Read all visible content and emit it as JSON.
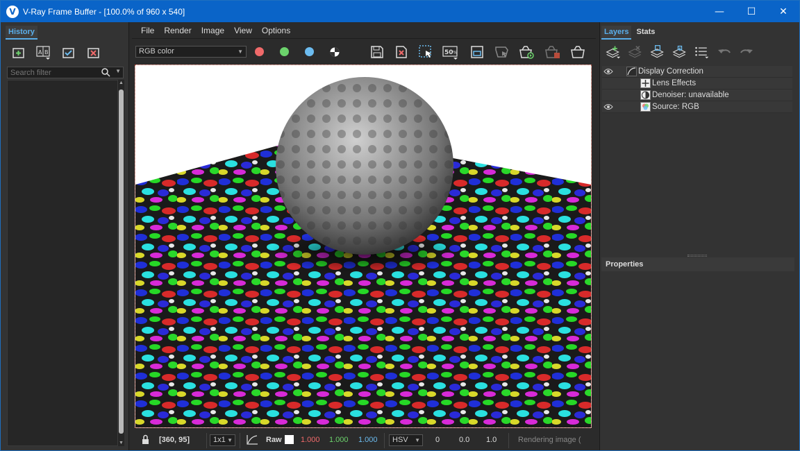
{
  "window": {
    "title": "V-Ray Frame Buffer - [100.0% of 960 x 540]",
    "app_icon_glyph": "V",
    "minimize": "—",
    "maximize": "☐",
    "close": "✕"
  },
  "history": {
    "tab_label": "History",
    "search_placeholder": "Search filter",
    "tool_icons": [
      "save-to-history-icon",
      "ab-compare-icon",
      "load-history-icon",
      "remove-history-icon"
    ]
  },
  "menu": {
    "items": [
      "File",
      "Render",
      "Image",
      "View",
      "Options"
    ]
  },
  "toolbar": {
    "channel_select_value": "RGB color",
    "channel_dots": [
      {
        "name": "red-channel",
        "color": "#f06a6a"
      },
      {
        "name": "green-channel",
        "color": "#6cd36c"
      },
      {
        "name": "blue-channel",
        "color": "#6cbcf0"
      }
    ],
    "icons": [
      "monochrome-icon",
      "save-image-icon",
      "clear-image-icon",
      "region-render-icon",
      "zoom-50-icon",
      "track-mouse-icon",
      "sync-icon",
      "render-interactive-icon",
      "stop-render-icon",
      "render-icon"
    ],
    "zoom_glyph": "50"
  },
  "statusbar": {
    "coords": "[360, 95]",
    "sample_select": "1x1",
    "raw_label": "Raw",
    "r": "1.000",
    "g": "1.000",
    "b": "1.000",
    "color_mode": "HSV",
    "h": "0",
    "s": "0.0",
    "v": "1.0",
    "status": "Rendering image ("
  },
  "right_panel": {
    "tabs": [
      "Layers",
      "Stats"
    ],
    "layers": [
      {
        "name": "Display Correction",
        "visible": true,
        "indent": 0
      },
      {
        "name": "Lens Effects",
        "visible": false,
        "indent": 1
      },
      {
        "name": "Denoiser: unavailable",
        "visible": false,
        "indent": 1
      },
      {
        "name": "Source: RGB",
        "visible": true,
        "indent": 1
      }
    ],
    "properties_label": "Properties"
  }
}
